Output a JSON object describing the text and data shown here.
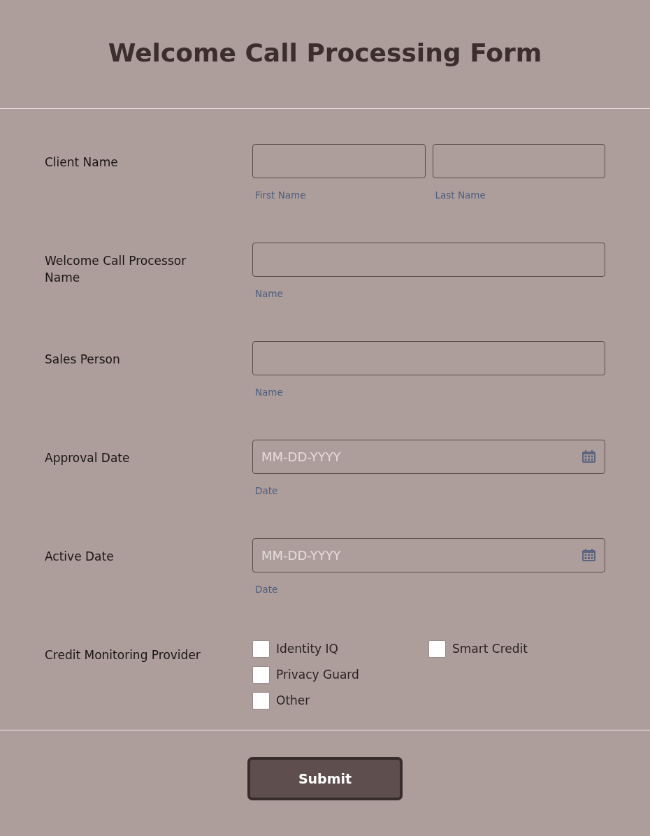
{
  "title": "Welcome Call Processing Form",
  "fields": [
    {
      "label": "Client Name",
      "kind": "text",
      "inputs": [
        {
          "sublabel": "First Name"
        },
        {
          "sublabel": "Last Name"
        }
      ]
    },
    {
      "label": "Welcome Call Processor Name",
      "kind": "text",
      "inputs": [
        {
          "sublabel": "Name"
        }
      ]
    },
    {
      "label": "Sales Person",
      "kind": "text",
      "inputs": [
        {
          "sublabel": "Name"
        }
      ]
    },
    {
      "label": "Approval Date",
      "kind": "date",
      "inputs": [
        {
          "sublabel": "Date",
          "placeholder": "MM-DD-YYYY"
        }
      ]
    },
    {
      "label": "Active Date",
      "kind": "date",
      "inputs": [
        {
          "sublabel": "Date",
          "placeholder": "MM-DD-YYYY"
        }
      ]
    },
    {
      "label": "Credit Monitoring Provider",
      "kind": "checkboxes",
      "options": [
        {
          "label": "Identity IQ",
          "checked": false
        },
        {
          "label": "Privacy Guard",
          "checked": false
        },
        {
          "label": "Other",
          "checked": false
        },
        {
          "label": "Smart Credit",
          "checked": false
        }
      ]
    }
  ],
  "submit": "Submit"
}
